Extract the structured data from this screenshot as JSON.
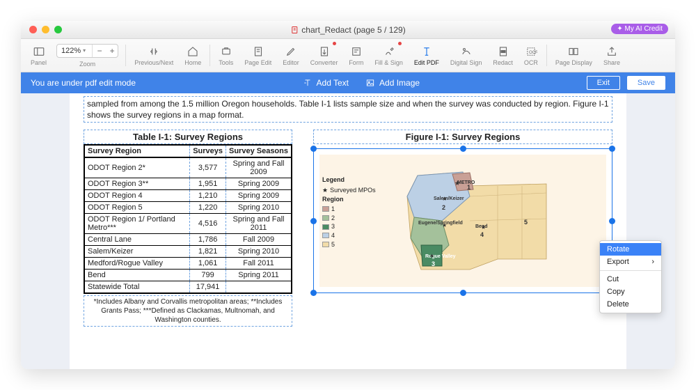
{
  "title": "chart_Redact (page 5 / 129)",
  "ai_badge": "✦ My AI Credit",
  "zoom": "122%",
  "toolbar": {
    "panel": "Panel",
    "zoom": "Zoom",
    "prevnext": "Previous/Next",
    "home": "Home",
    "tools": "Tools",
    "pageedit": "Page Edit",
    "editor": "Editor",
    "converter": "Converter",
    "form": "Form",
    "fillsign": "Fill & Sign",
    "editpdf": "Edit PDF",
    "digital": "Digital Sign",
    "redact": "Redact",
    "ocr": "OCR",
    "pagedisplay": "Page Display",
    "share": "Share"
  },
  "bluebar": {
    "msg": "You are under pdf edit mode",
    "addtext": "Add Text",
    "addimage": "Add Image",
    "exit": "Exit",
    "save": "Save"
  },
  "paragraph": "sampled from among the 1.5 million Oregon households. Table I-1 lists sample size and when the survey was conducted by region. Figure I-1 shows the survey regions in a map format.",
  "table_caption": "Table I-1:  Survey Regions",
  "figure_caption": "Figure I-1:  Survey Regions",
  "headers": {
    "c1": "Survey Region",
    "c2": "Surveys",
    "c3": "Survey Seasons"
  },
  "rows": [
    {
      "r": "ODOT Region 2*",
      "s": "3,577",
      "t": "Spring and Fall 2009"
    },
    {
      "r": "ODOT Region 3**",
      "s": "1,951",
      "t": "Spring 2009"
    },
    {
      "r": "ODOT Region 4",
      "s": "1,210",
      "t": "Spring 2009"
    },
    {
      "r": "ODOT Region 5",
      "s": "1,220",
      "t": "Spring 2010"
    },
    {
      "r": "ODOT Region 1/ Portland Metro***",
      "s": "4,516",
      "t": "Spring and Fall 2011"
    },
    {
      "r": "Central Lane",
      "s": "1,786",
      "t": "Fall 2009"
    },
    {
      "r": "Salem/Keizer",
      "s": "1,821",
      "t": "Spring 2010"
    },
    {
      "r": "Medford/Rogue Valley",
      "s": "1,061",
      "t": "Fall 2011"
    },
    {
      "r": "Bend",
      "s": "799",
      "t": "Spring 2011"
    },
    {
      "r": "Statewide Total",
      "s": "17,941",
      "t": ""
    }
  ],
  "footnote": "*Includes Albany and Corvallis metropolitan areas; **Includes Grants Pass; ***Defined as Clackamas, Multnomah, and Washington counties.",
  "legend": {
    "title": "Legend",
    "surveyed": "Surveyed MPOs",
    "region": "Region",
    "r1": "1",
    "r2": "2",
    "r3": "3",
    "r4": "4",
    "r5": "5",
    "colors": {
      "1": "#c9a096",
      "2": "#a4c19b",
      "3": "#4a8b63",
      "4": "#bcd0e5",
      "5": "#f2dca8"
    }
  },
  "map_labels": {
    "metro": "METRO",
    "salem": "Salem/Keizer",
    "eugene": "Eugene/Springfield",
    "bend": "Bend",
    "rogue": "Rogue Valley"
  },
  "menu": {
    "rotate": "Rotate",
    "export": "Export",
    "cut": "Cut",
    "copy": "Copy",
    "delete": "Delete"
  }
}
